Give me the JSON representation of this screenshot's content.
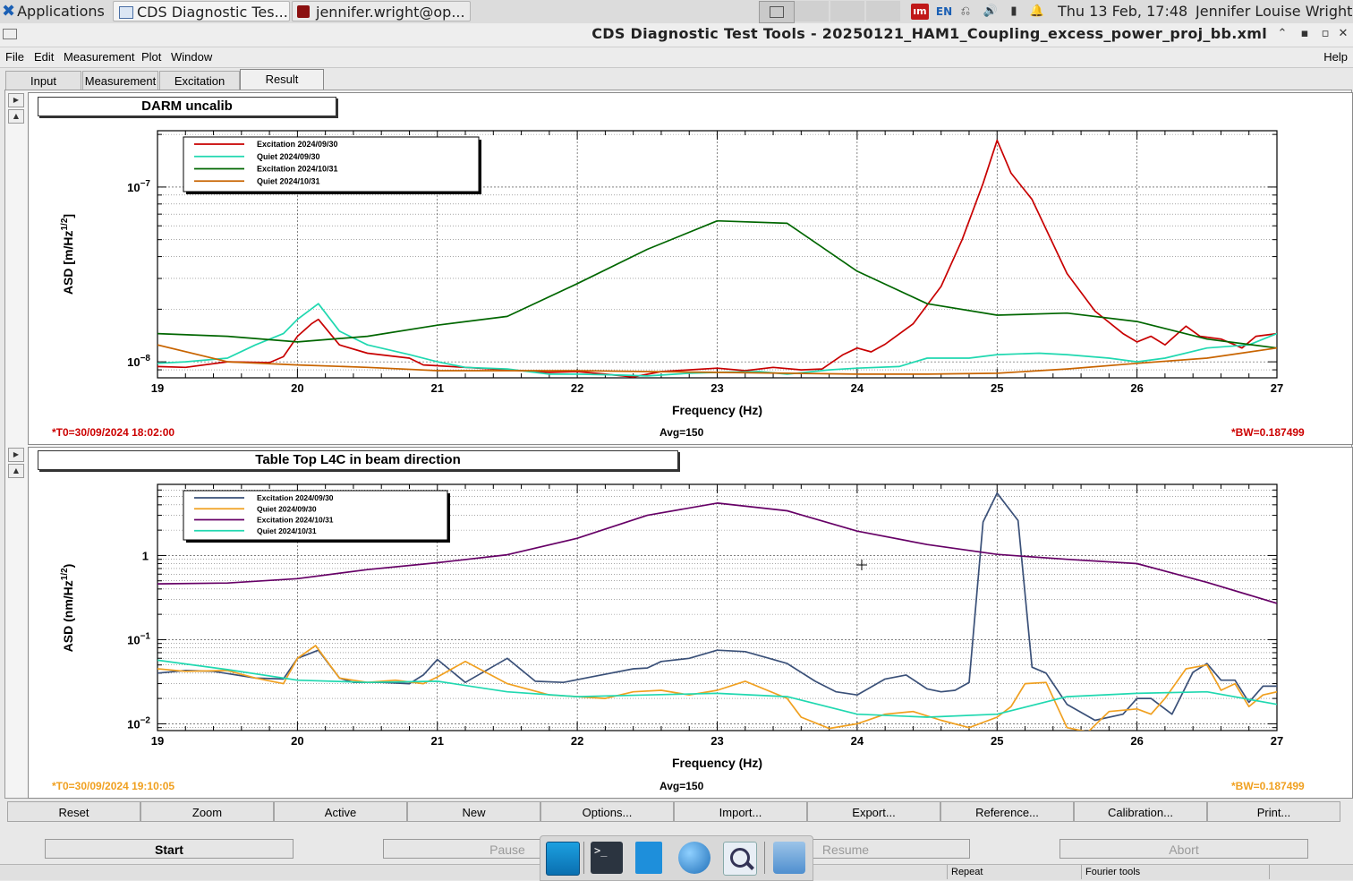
{
  "taskbar": {
    "apps_label": "Applications",
    "tasks": [
      "CDS Diagnostic Tes...",
      "jennifer.wright@op..."
    ],
    "lang": "EN",
    "clock": "Thu 13 Feb, 17:48",
    "user": "Jennifer Louise Wright"
  },
  "window": {
    "title": "CDS Diagnostic Test Tools - 20250121_HAM1_Coupling_excess_power_proj_bb.xml"
  },
  "menubar": {
    "items": [
      "File",
      "Edit",
      "Measurement",
      "Plot",
      "Window"
    ],
    "help": "Help"
  },
  "tabs": [
    "Input",
    "Measurement",
    "Excitation",
    "Result"
  ],
  "active_tab": "Result",
  "plots": [
    {
      "title": "DARM uncalib",
      "t0": "*T0=30/09/2024 18:02:00",
      "avg": "Avg=150",
      "bw": "*BW=0.187499",
      "info_color": "#cc0000",
      "ylabel_main": "ASD [m/Hz",
      "ylabel_sup": "1/2",
      "ylabel_close": "]"
    },
    {
      "title": "Table Top L4C in beam direction",
      "t0": "*T0=30/09/2024 19:10:05",
      "avg": "Avg=150",
      "bw": "*BW=0.187499",
      "info_color": "#f0a020",
      "ylabel_main": "ASD (nm/Hz",
      "ylabel_sup": "1/2",
      "ylabel_close": ")"
    }
  ],
  "chart_data": [
    {
      "type": "line",
      "title": "DARM uncalib",
      "xlabel": "Frequency (Hz)",
      "ylabel": "ASD [m/Hz^1/2]",
      "xlim": [
        19,
        27
      ],
      "ylim": [
        8.1e-09,
        2.1e-07
      ],
      "yscale": "log",
      "grid": true,
      "legend": "top-left",
      "x_ticks": [
        "19",
        "20",
        "21",
        "22",
        "23",
        "24",
        "25",
        "26",
        "27"
      ],
      "y_ticks": [
        {
          "base": "10",
          "exp": "−7",
          "value": 1e-07
        },
        {
          "base": "10",
          "exp": "−8",
          "value": 1e-08
        }
      ],
      "series": [
        {
          "name": "Excitation 2024/09/30",
          "color": "#c80000",
          "x": [
            19,
            19.2,
            19.5,
            19.8,
            19.9,
            20,
            20.1,
            20.15,
            20.3,
            20.5,
            20.8,
            20.9,
            21,
            21.2,
            21.5,
            21.8,
            22,
            22.2,
            22.4,
            22.6,
            22.8,
            23,
            23.2,
            23.4,
            23.6,
            23.75,
            23.9,
            24,
            24.1,
            24.2,
            24.4,
            24.6,
            24.75,
            24.9,
            25,
            25.1,
            25.25,
            25.5,
            25.7,
            25.9,
            26,
            26.1,
            26.2,
            26.35,
            26.45,
            26.6,
            26.7,
            26.75,
            26.85,
            27
          ],
          "y": [
            9.4e-09,
            9.3e-09,
            1e-08,
            9.9e-09,
            1.07e-08,
            1.4e-08,
            1.65e-08,
            1.75e-08,
            1.25e-08,
            1.12e-08,
            1.05e-08,
            9.6e-09,
            9.5e-09,
            9.3e-09,
            9e-09,
            8.7e-09,
            8.8e-09,
            8.5e-09,
            8.2e-09,
            8.8e-09,
            9e-09,
            9.2e-09,
            8.9e-09,
            9.3e-09,
            9e-09,
            9.1e-09,
            1.1e-08,
            1.2e-08,
            1.14e-08,
            1.26e-08,
            1.65e-08,
            2.7e-08,
            5e-08,
            1.05e-07,
            1.85e-07,
            1.2e-07,
            8.5e-08,
            3.2e-08,
            1.95e-08,
            1.45e-08,
            1.3e-08,
            1.4e-08,
            1.25e-08,
            1.6e-08,
            1.4e-08,
            1.35e-08,
            1.25e-08,
            1.2e-08,
            1.4e-08,
            1.45e-08
          ]
        },
        {
          "name": "Quiet 2024/09/30",
          "color": "#20d8b0",
          "x": [
            19,
            19.2,
            19.5,
            19.7,
            19.9,
            20,
            20.15,
            20.3,
            20.5,
            20.8,
            21,
            21.2,
            21.5,
            21.8,
            22,
            22.3,
            22.5,
            22.8,
            23,
            23.3,
            23.5,
            23.8,
            24,
            24.3,
            24.5,
            24.8,
            25,
            25.3,
            25.5,
            25.8,
            26,
            26.2,
            26.5,
            26.8,
            27
          ],
          "y": [
            9.8e-09,
            1e-08,
            1.05e-08,
            1.25e-08,
            1.45e-08,
            1.75e-08,
            2.15e-08,
            1.5e-08,
            1.25e-08,
            1.1e-08,
            1e-08,
            9.3e-09,
            9.1e-09,
            8.5e-09,
            8.5e-09,
            8.4e-09,
            8.3e-09,
            8.6e-09,
            8.7e-09,
            8.8e-09,
            8.5e-09,
            9e-09,
            9.2e-09,
            9.4e-09,
            1.05e-08,
            1.05e-08,
            1.1e-08,
            1.12e-08,
            1.1e-08,
            1.05e-08,
            1e-08,
            1.05e-08,
            1.2e-08,
            1.25e-08,
            1.45e-08
          ]
        },
        {
          "name": "Excitation 2024/10/31",
          "color": "#006600",
          "x": [
            19,
            19.5,
            20,
            20.5,
            21,
            21.5,
            22,
            22.5,
            23,
            23.5,
            24,
            24.5,
            25,
            25.5,
            26,
            26.5,
            27
          ],
          "y": [
            1.45e-08,
            1.4e-08,
            1.3e-08,
            1.4e-08,
            1.62e-08,
            1.82e-08,
            2.8e-08,
            4.4e-08,
            6.4e-08,
            6.2e-08,
            3.3e-08,
            2.15e-08,
            1.85e-08,
            1.9e-08,
            1.7e-08,
            1.35e-08,
            1.2e-08
          ]
        },
        {
          "name": "Quiet 2024/10/31",
          "color": "#c86400",
          "x": [
            19,
            19.5,
            20,
            20.5,
            21,
            21.5,
            22,
            22.5,
            23,
            23.5,
            24,
            24.5,
            25,
            25.5,
            26,
            26.5,
            27
          ],
          "y": [
            1.25e-08,
            1e-08,
            9.6e-09,
            9.3e-09,
            8.9e-09,
            8.9e-09,
            8.9e-09,
            8.8e-09,
            8.7e-09,
            8.6e-09,
            8.5e-09,
            8.5e-09,
            8.6e-09,
            9.1e-09,
            9.8e-09,
            1.05e-08,
            1.2e-08
          ]
        }
      ]
    },
    {
      "type": "line",
      "title": "Table Top L4C in beam direction",
      "xlabel": "Frequency (Hz)",
      "ylabel": "ASD (nm/Hz^1/2)",
      "xlim": [
        19,
        27
      ],
      "ylim": [
        0.0083,
        7.0
      ],
      "yscale": "log",
      "grid": true,
      "legend": "top-left",
      "x_ticks": [
        "19",
        "20",
        "21",
        "22",
        "23",
        "24",
        "25",
        "26",
        "27"
      ],
      "y_ticks": [
        {
          "base": "1",
          "exp": "",
          "value": 1
        },
        {
          "base": "10",
          "exp": "−1",
          "value": 0.1
        },
        {
          "base": "10",
          "exp": "−2",
          "value": 0.01
        }
      ],
      "series": [
        {
          "name": "Excitation 2024/09/30",
          "color": "#3a5078",
          "x": [
            19,
            19.2,
            19.4,
            19.7,
            19.9,
            20,
            20.15,
            20.3,
            20.4,
            20.6,
            20.8,
            20.9,
            21,
            21.2,
            21.5,
            21.7,
            21.9,
            22.1,
            22.4,
            22.5,
            22.6,
            22.8,
            23,
            23.2,
            23.4,
            23.5,
            23.7,
            23.85,
            24,
            24.2,
            24.35,
            24.5,
            24.6,
            24.7,
            24.8,
            24.9,
            25,
            25.15,
            25.25,
            25.35,
            25.5,
            25.7,
            25.9,
            26,
            26.1,
            26.25,
            26.4,
            26.5,
            26.6,
            26.7,
            26.8,
            26.9,
            27
          ],
          "y": [
            0.04,
            0.043,
            0.042,
            0.035,
            0.034,
            0.06,
            0.075,
            0.035,
            0.031,
            0.031,
            0.03,
            0.038,
            0.058,
            0.031,
            0.06,
            0.032,
            0.031,
            0.036,
            0.045,
            0.046,
            0.055,
            0.06,
            0.075,
            0.072,
            0.058,
            0.052,
            0.032,
            0.024,
            0.022,
            0.034,
            0.038,
            0.026,
            0.024,
            0.025,
            0.031,
            2.5,
            5.5,
            2.6,
            0.047,
            0.04,
            0.017,
            0.011,
            0.013,
            0.02,
            0.02,
            0.013,
            0.041,
            0.052,
            0.033,
            0.033,
            0.018,
            0.028,
            0.028
          ]
        },
        {
          "name": "Quiet 2024/09/30",
          "color": "#f0a020",
          "x": [
            19,
            19.2,
            19.5,
            19.7,
            19.9,
            20,
            20.13,
            20.3,
            20.5,
            20.7,
            20.9,
            21,
            21.2,
            21.5,
            21.8,
            22,
            22.2,
            22.4,
            22.6,
            22.8,
            23,
            23.2,
            23.5,
            23.6,
            23.8,
            24,
            24.2,
            24.4,
            24.6,
            24.8,
            25,
            25.1,
            25.2,
            25.35,
            25.5,
            25.65,
            25.8,
            26,
            26.1,
            26.2,
            26.35,
            26.5,
            26.6,
            26.7,
            26.8,
            26.9,
            27
          ],
          "y": [
            0.045,
            0.042,
            0.043,
            0.035,
            0.03,
            0.06,
            0.085,
            0.035,
            0.031,
            0.033,
            0.03,
            0.036,
            0.055,
            0.03,
            0.022,
            0.021,
            0.02,
            0.024,
            0.025,
            0.022,
            0.025,
            0.032,
            0.02,
            0.012,
            0.0088,
            0.01,
            0.013,
            0.014,
            0.011,
            0.009,
            0.012,
            0.016,
            0.03,
            0.031,
            0.009,
            0.008,
            0.014,
            0.015,
            0.013,
            0.02,
            0.045,
            0.05,
            0.025,
            0.03,
            0.016,
            0.022,
            0.024
          ]
        },
        {
          "name": "Excitation 2024/10/31",
          "color": "#660066",
          "x": [
            19,
            19.5,
            20,
            20.5,
            21,
            21.5,
            22,
            22.5,
            23,
            23.5,
            24,
            24.5,
            25,
            25.5,
            26,
            26.5,
            27
          ],
          "y": [
            0.46,
            0.47,
            0.53,
            0.68,
            0.82,
            1.02,
            1.6,
            3.0,
            4.2,
            3.4,
            1.95,
            1.35,
            1.03,
            0.9,
            0.8,
            0.48,
            0.27
          ]
        },
        {
          "name": "Quiet 2024/10/31",
          "color": "#20d8b0",
          "x": [
            19,
            19.5,
            20,
            20.5,
            21,
            21.5,
            22,
            22.5,
            23,
            23.5,
            24,
            24.5,
            25,
            25.5,
            26,
            26.5,
            27
          ],
          "y": [
            0.057,
            0.044,
            0.033,
            0.031,
            0.032,
            0.024,
            0.021,
            0.022,
            0.023,
            0.021,
            0.013,
            0.012,
            0.013,
            0.021,
            0.023,
            0.024,
            0.017
          ]
        }
      ]
    }
  ],
  "buttons": [
    "Reset",
    "Zoom",
    "Active",
    "New",
    "Options...",
    "Import...",
    "Export...",
    "Reference...",
    "Calibration...",
    "Print..."
  ],
  "control": {
    "start": "Start",
    "pause": "Pause",
    "resume": "Resume",
    "abort": "Abort"
  },
  "status": {
    "repeat": "Repeat",
    "fourier": "Fourier tools"
  }
}
